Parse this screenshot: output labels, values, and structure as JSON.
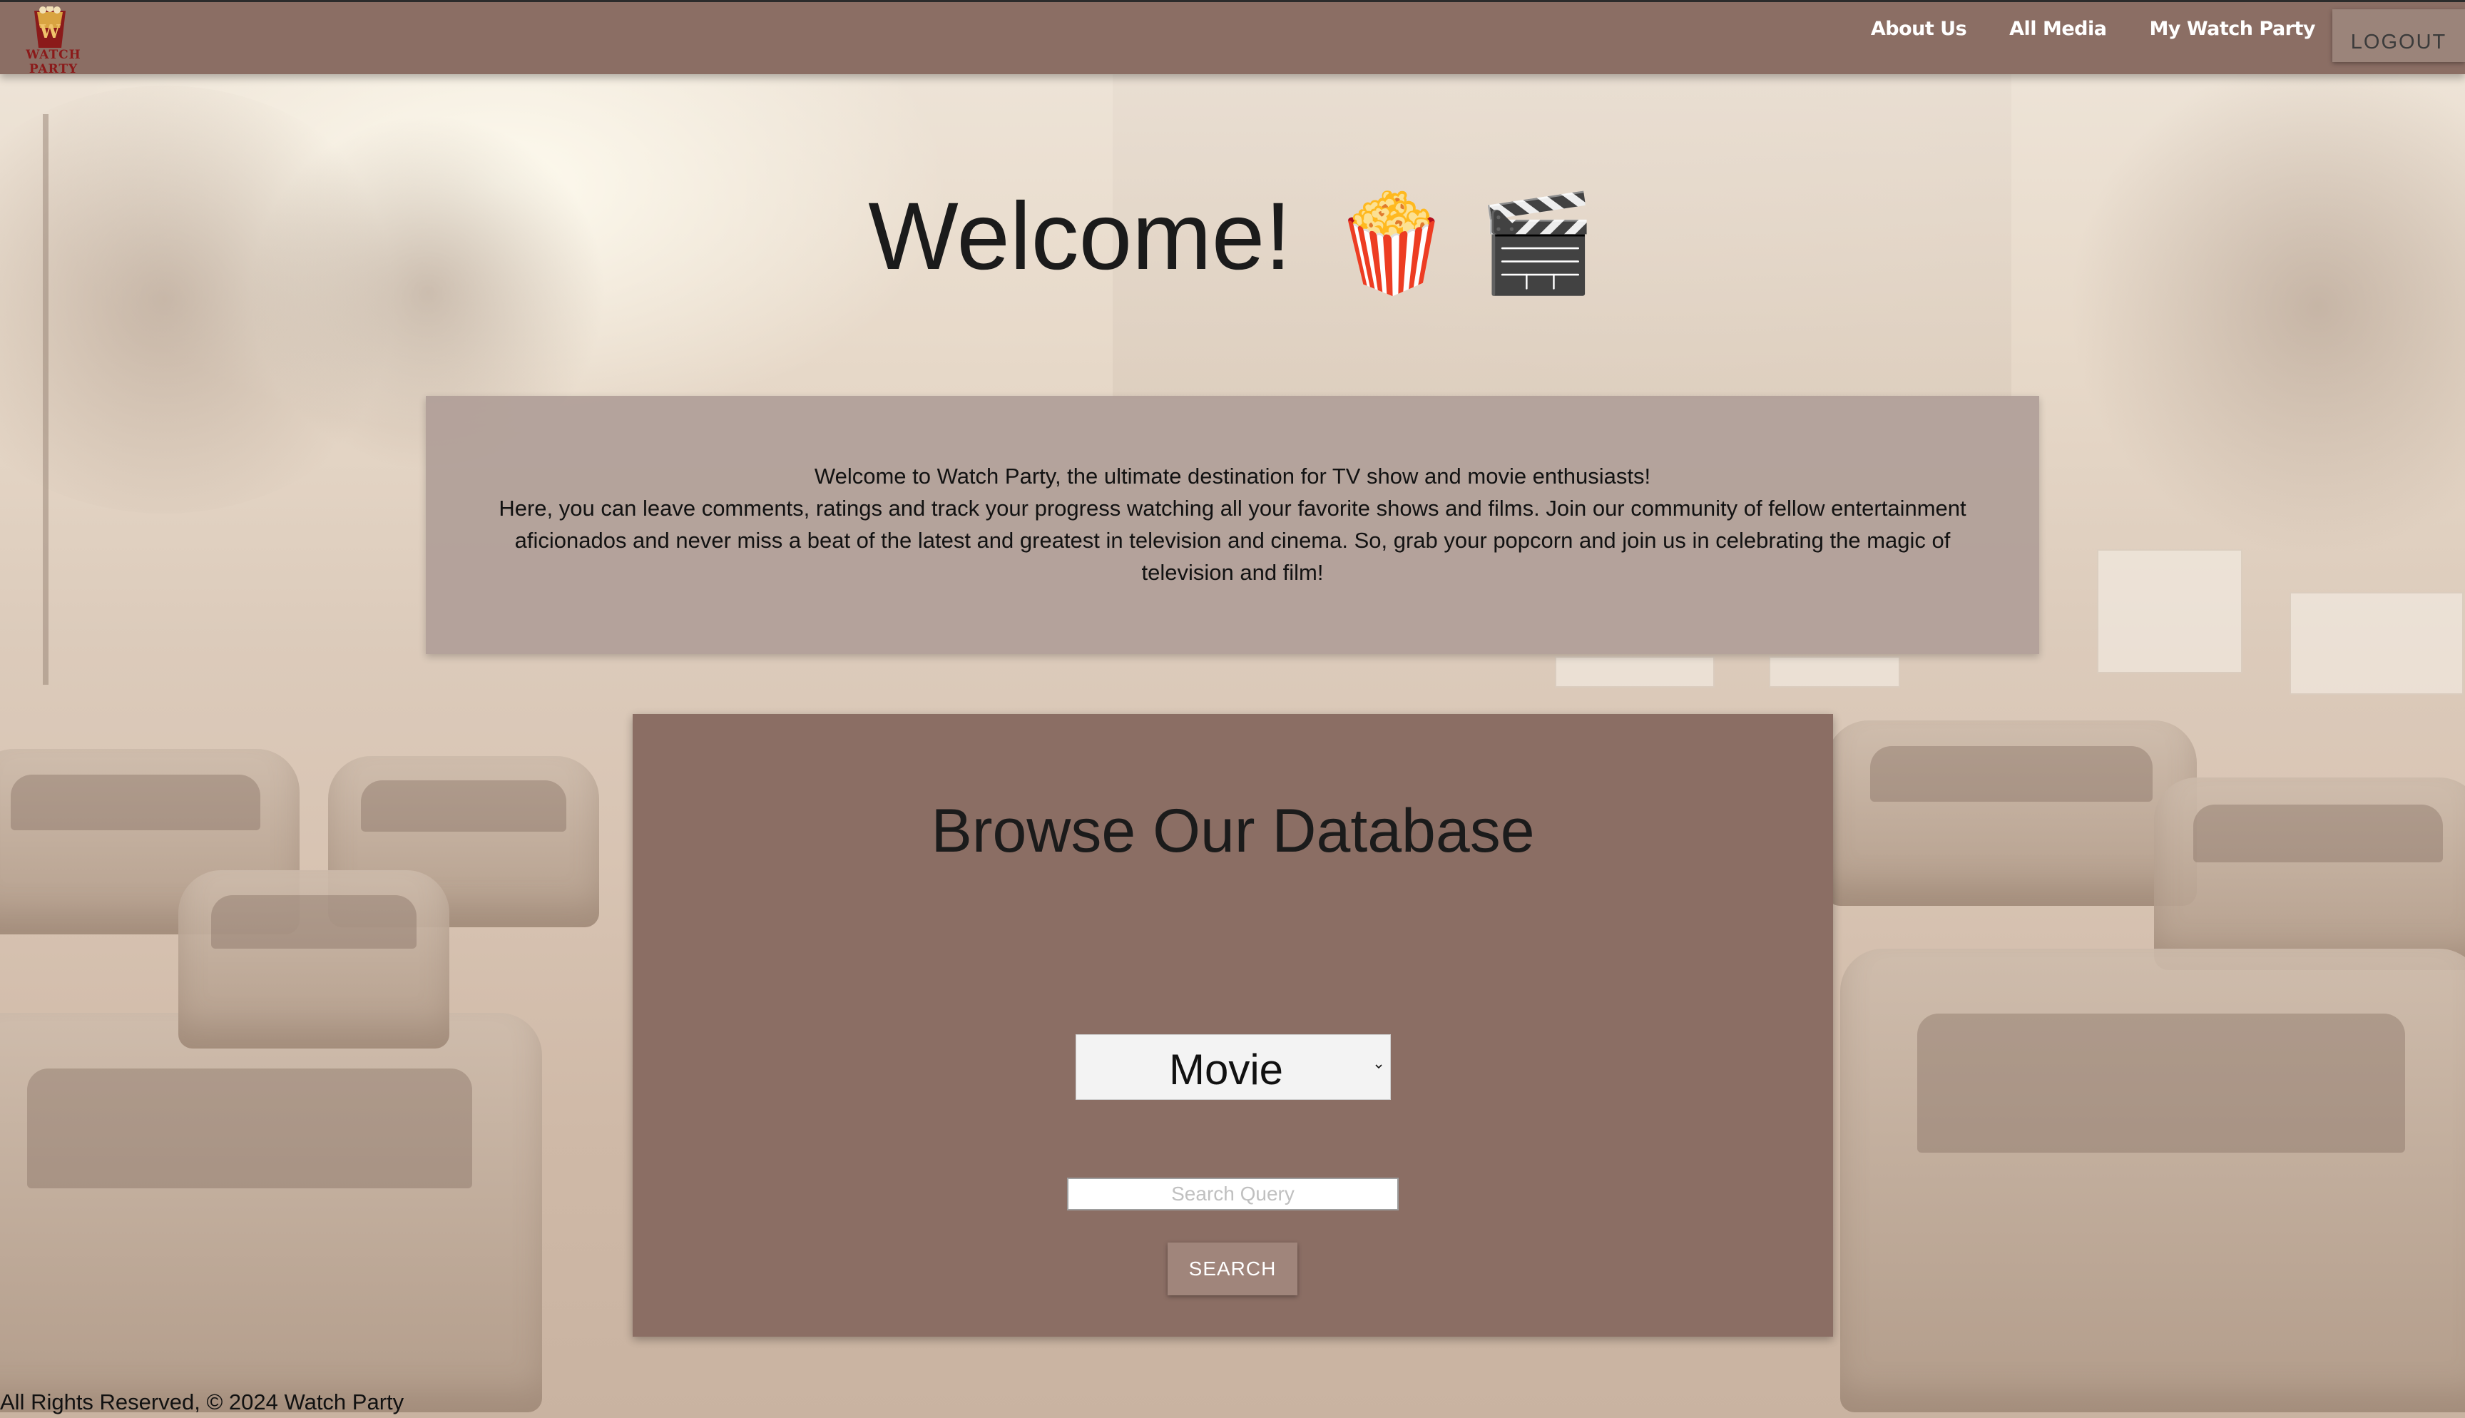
{
  "header": {
    "logo_text": "WATCH PARTY",
    "nav": [
      {
        "label": "About Us"
      },
      {
        "label": "All Media"
      },
      {
        "label": "My Watch Party"
      }
    ],
    "logout_label": "LOGOUT"
  },
  "welcome": {
    "title": "Welcome!",
    "emoji_popcorn": "🍿",
    "emoji_clapper": "🎬"
  },
  "intro": {
    "line1": "Welcome to Watch Party, the ultimate destination for TV show and movie enthusiasts!",
    "line2": "Here, you can leave comments, ratings and track your progress watching all your favorite shows and films. Join our community of fellow entertainment aficionados and never miss a beat of the latest and greatest in television and cinema. So, grab your popcorn and join us in celebrating the magic of television and film!"
  },
  "browse": {
    "title": "Browse Our Database",
    "media_type_selected": "Movie",
    "search_placeholder": "Search Query",
    "search_button_label": "SEARCH"
  },
  "footer": {
    "text": "All Rights Reserved, © 2024 Watch Party"
  },
  "colors": {
    "navbar": "#8b6e64",
    "card": "#8b6e64",
    "intro_card": "#b09e98",
    "logo_red": "#8b1a1a"
  },
  "icons": {
    "logo": "trophy-cup-logo-icon",
    "select_chevron": "chevron-down-icon"
  }
}
